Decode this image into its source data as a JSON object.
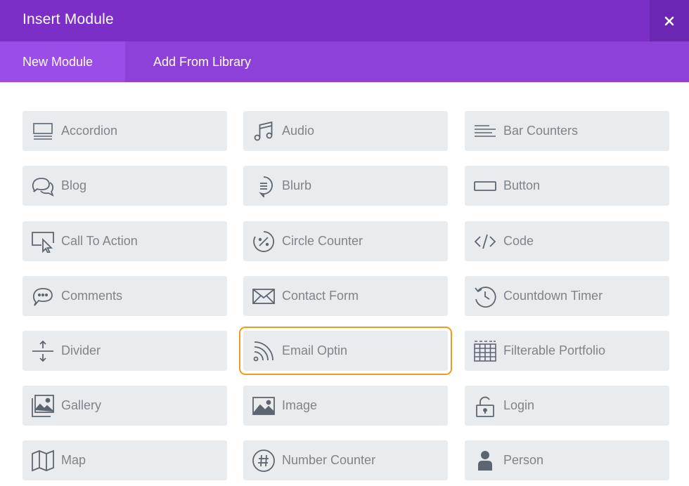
{
  "dialog": {
    "title": "Insert Module",
    "close_icon": "close-icon"
  },
  "tabs": [
    {
      "label": "New Module",
      "active": true
    },
    {
      "label": "Add From Library",
      "active": false
    }
  ],
  "modules": [
    {
      "label": "Accordion",
      "icon": "accordion-icon"
    },
    {
      "label": "Audio",
      "icon": "music-note-icon"
    },
    {
      "label": "Bar Counters",
      "icon": "bar-counters-icon"
    },
    {
      "label": "Blog",
      "icon": "chat-bubbles-icon"
    },
    {
      "label": "Blurb",
      "icon": "blurb-bubble-icon"
    },
    {
      "label": "Button",
      "icon": "button-icon"
    },
    {
      "label": "Call To Action",
      "icon": "cursor-screen-icon"
    },
    {
      "label": "Circle Counter",
      "icon": "circle-counter-icon"
    },
    {
      "label": "Code",
      "icon": "code-icon"
    },
    {
      "label": "Comments",
      "icon": "comments-icon"
    },
    {
      "label": "Contact Form",
      "icon": "envelope-icon"
    },
    {
      "label": "Countdown Timer",
      "icon": "clock-icon"
    },
    {
      "label": "Divider",
      "icon": "divider-icon"
    },
    {
      "label": "Email Optin",
      "icon": "rss-icon",
      "highlighted": true
    },
    {
      "label": "Filterable Portfolio",
      "icon": "grid-table-icon"
    },
    {
      "label": "Gallery",
      "icon": "gallery-icon"
    },
    {
      "label": "Image",
      "icon": "image-icon"
    },
    {
      "label": "Login",
      "icon": "padlock-icon"
    },
    {
      "label": "Map",
      "icon": "map-icon"
    },
    {
      "label": "Number Counter",
      "icon": "hash-icon"
    },
    {
      "label": "Person",
      "icon": "person-icon"
    }
  ],
  "colors": {
    "titlebar": "#7b2fc7",
    "tabbar": "#8d41d8",
    "active_tab": "#9b4de8",
    "module_bg": "#e9ecef",
    "module_text": "#7d848b",
    "highlight_outline": "#f29a1d"
  }
}
